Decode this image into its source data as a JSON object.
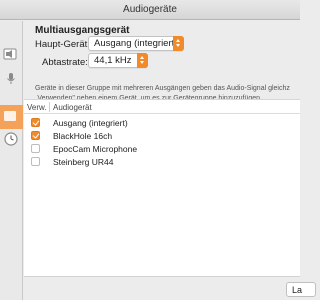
{
  "window": {
    "title": "Audiogeräte"
  },
  "sidebar": {
    "items": [
      {
        "icon": "speaker-icon",
        "selected": false
      },
      {
        "icon": "microphone-icon",
        "selected": false
      },
      {
        "icon": "aggregate-device-icon",
        "selected": true
      },
      {
        "icon": "clock-icon",
        "selected": false
      }
    ]
  },
  "panel": {
    "section_title": "Multiausgangsgerät",
    "main_device_label": "Haupt-Gerät:",
    "main_device_value": "Ausgang (integriert)",
    "samplerate_label": "Abtastrate:",
    "samplerate_value": "44,1 kHz",
    "info_line1": "Geräte in dieser Gruppe mit mehreren Ausgängen geben das Audio-Signal gleichz",
    "info_line2": "„Verwenden\" neben einem Gerät, um es zur Gerätegruppe hinzuzufügen."
  },
  "table": {
    "headers": {
      "use": "Verw.",
      "device": "Audiogerät"
    },
    "rows": [
      {
        "name": "Ausgang (integriert)",
        "checked": true
      },
      {
        "name": "BlackHole 16ch",
        "checked": true
      },
      {
        "name": "EpocCam Microphone",
        "checked": false
      },
      {
        "name": "Steinberg UR44",
        "checked": false
      }
    ]
  },
  "footer": {
    "button_label": "La"
  },
  "colors": {
    "accent": "#f08a2a",
    "selection": "#f4a15a"
  }
}
